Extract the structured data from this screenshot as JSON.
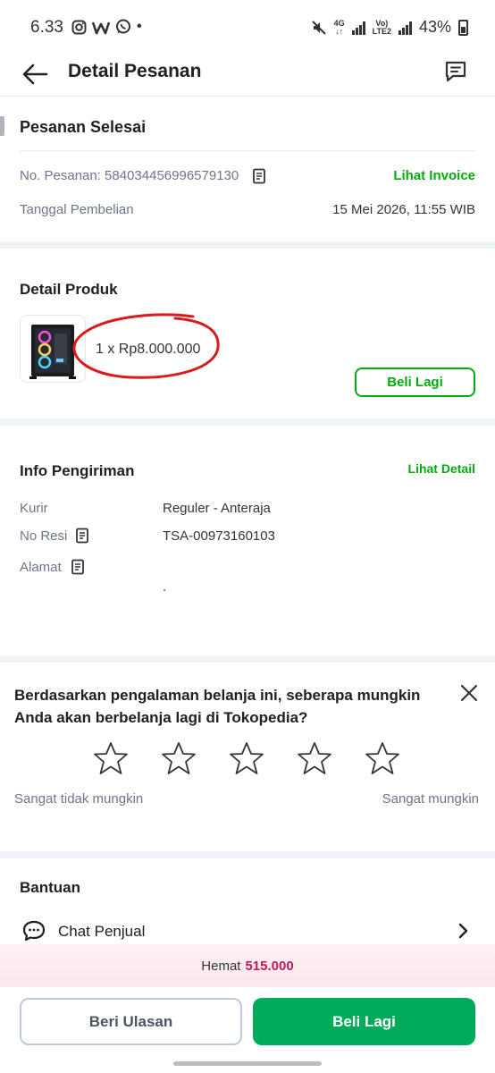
{
  "status_bar": {
    "time": "6.33",
    "app_icons": [
      "instagram-icon",
      "w-app-icon",
      "whatsapp-icon"
    ],
    "dot": "•",
    "net1": "4G",
    "net2_top": "Vo)",
    "net2_bottom": "LTE2",
    "battery": "43%"
  },
  "header": {
    "title": "Detail Pesanan"
  },
  "order": {
    "status": "Pesanan Selesai",
    "number_label": "No. Pesanan: 584034456996579130",
    "invoice_link": "Lihat Invoice",
    "date_label": "Tanggal Pembelian",
    "date_value": "15 Mei 2026, 11:55 WIB"
  },
  "product": {
    "section_title": "Detail Produk",
    "qty_price": "1 x Rp8.000.000",
    "buy_again": "Beli Lagi"
  },
  "shipping": {
    "section_title": "Info Pengiriman",
    "detail_link": "Lihat Detail",
    "courier_label": "Kurir",
    "courier_value": "Reguler - Anteraja",
    "resi_label": "No Resi",
    "resi_value": "TSA-00973160103",
    "address_label": "Alamat",
    "address_value": "."
  },
  "survey": {
    "question": "Berdasarkan pengalaman belanja ini, seberapa mungkin Anda akan berbelanja lagi di Tokopedia?",
    "rating": 0,
    "max_rating": 5,
    "left_label": "Sangat tidak mungkin",
    "right_label": "Sangat mungkin"
  },
  "help": {
    "section_title": "Bantuan",
    "chat_label": "Chat Penjual"
  },
  "bottom": {
    "hemat_label": "Hemat",
    "hemat_value": "515.000",
    "review_button": "Beri Ulasan",
    "buy_again_button": "Beli Lagi"
  },
  "colors": {
    "accent_green": "#03ac0e",
    "primary_button": "#00aa5b",
    "hemat_value": "#c2185b",
    "annotation_circle": "#d81b1b"
  }
}
